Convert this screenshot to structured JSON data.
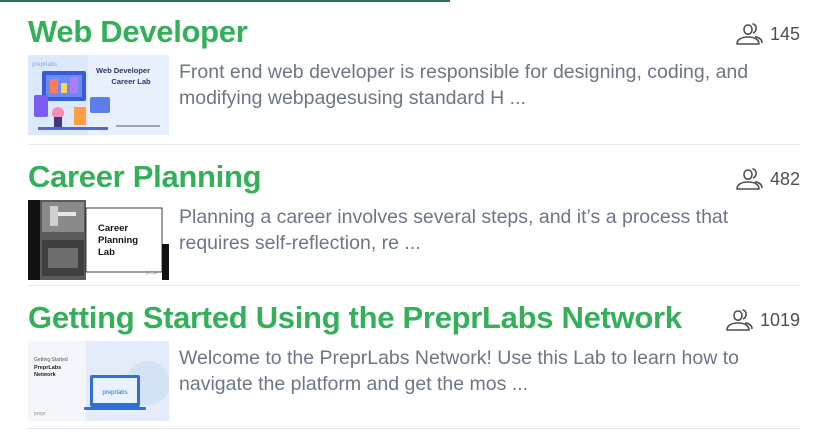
{
  "labs": [
    {
      "title": "Web Developer",
      "participants": "145",
      "description": "Front end web developer is responsible for designing, coding, and modifying webpagesusing standard H ...",
      "thumbnail": {
        "heading": "Web Developer Career Lab",
        "brand": "preprlabs"
      }
    },
    {
      "title": "Career Planning",
      "participants": "482",
      "description": "Planning a career involves several steps, and it’s a process that requires self-reflection, re ...",
      "thumbnail": {
        "heading": "Career Planning Lab",
        "brand": "preprlabs"
      }
    },
    {
      "title": "Getting Started Using the PreprLabs Network",
      "participants": "1019",
      "description": "Welcome to the PreprLabs Network! Use this Lab to learn how to navigate the platform and get the mos ...",
      "thumbnail": {
        "heading": "Getting Started PreprLabs Network",
        "brand": "preprlabs"
      }
    }
  ],
  "colors": {
    "title": "#35b05a",
    "description": "#6b7686",
    "count": "#4a4f57"
  },
  "icons": {
    "participants": "people-icon"
  }
}
